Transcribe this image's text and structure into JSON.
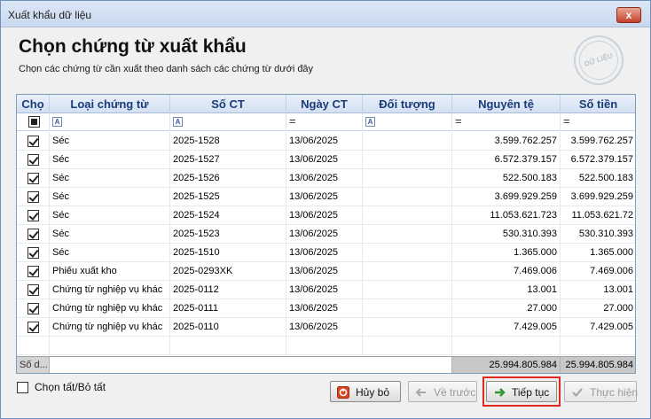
{
  "window": {
    "title": "Xuất khẩu dữ liệu",
    "close_label": "x"
  },
  "header": {
    "title": "Chọn chứng từ xuất khẩu",
    "subtitle": "Chọn các chứng từ cần xuất theo danh sách các chứng từ dưới đây",
    "stamp_text": "DỮ LIỆU MẪU"
  },
  "table": {
    "columns": [
      "Chọ",
      "Loại chứng từ",
      "Số CT",
      "Ngày CT",
      "Đối tượng",
      "Nguyên tệ",
      "Số tiền"
    ],
    "filter_symbols": [
      "A",
      "A",
      "=",
      "A",
      "=",
      "="
    ],
    "rows": [
      {
        "checked": true,
        "type": "Séc",
        "number": "2025-1528",
        "date": "13/06/2025",
        "party": "",
        "orig": "3.599.762.257",
        "amount": "3.599.762.257"
      },
      {
        "checked": true,
        "type": "Séc",
        "number": "2025-1527",
        "date": "13/06/2025",
        "party": "",
        "orig": "6.572.379.157",
        "amount": "6.572.379.157"
      },
      {
        "checked": true,
        "type": "Séc",
        "number": "2025-1526",
        "date": "13/06/2025",
        "party": "",
        "orig": "522.500.183",
        "amount": "522.500.183"
      },
      {
        "checked": true,
        "type": "Séc",
        "number": "2025-1525",
        "date": "13/06/2025",
        "party": "",
        "orig": "3.699.929.259",
        "amount": "3.699.929.259"
      },
      {
        "checked": true,
        "type": "Séc",
        "number": "2025-1524",
        "date": "13/06/2025",
        "party": "",
        "orig": "11.053.621.723",
        "amount": "11.053.621.72"
      },
      {
        "checked": true,
        "type": "Séc",
        "number": "2025-1523",
        "date": "13/06/2025",
        "party": "",
        "orig": "530.310.393",
        "amount": "530.310.393"
      },
      {
        "checked": true,
        "type": "Séc",
        "number": "2025-1510",
        "date": "13/06/2025",
        "party": "",
        "orig": "1.365.000",
        "amount": "1.365.000"
      },
      {
        "checked": true,
        "type": "Phiếu xuất kho",
        "number": "2025-0293XK",
        "date": "13/06/2025",
        "party": "",
        "orig": "7.469.006",
        "amount": "7.469.006"
      },
      {
        "checked": true,
        "type": "Chứng từ nghiệp vụ khác",
        "number": "2025-0112",
        "date": "13/06/2025",
        "party": "",
        "orig": "13.001",
        "amount": "13.001"
      },
      {
        "checked": true,
        "type": "Chứng từ nghiệp vụ khác",
        "number": "2025-0111",
        "date": "13/06/2025",
        "party": "",
        "orig": "27.000",
        "amount": "27.000"
      },
      {
        "checked": true,
        "type": "Chứng từ nghiệp vụ khác",
        "number": "2025-0110",
        "date": "13/06/2025",
        "party": "",
        "orig": "7.429.005",
        "amount": "7.429.005"
      }
    ],
    "footer": {
      "label": "Số d...",
      "orig_total": "25.994.805.984",
      "amount_total": "25.994.805.984"
    }
  },
  "select_all": {
    "label": "Chọn tất/Bỏ tất",
    "checked": false
  },
  "buttons": {
    "cancel": "Hủy bỏ",
    "back": "Về trước",
    "next": "Tiếp tục",
    "execute": "Thực hiện"
  },
  "colors": {
    "accent": "#1b3c78",
    "focus_border": "#e0281e",
    "next_arrow": "#2e9a2e",
    "cancel_icon": "#d9461f"
  }
}
